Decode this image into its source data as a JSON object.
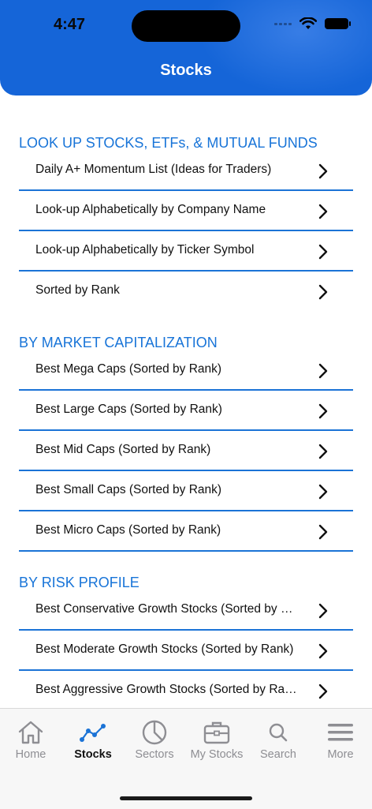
{
  "status": {
    "time": "4:47"
  },
  "header": {
    "title": "Stocks"
  },
  "sections": [
    {
      "title": "LOOK UP STOCKS, ETFs, & MUTUAL FUNDS",
      "items": [
        "Daily A+ Momentum List (Ideas for Traders)",
        "Look-up Alphabetically by Company Name",
        "Look-up Alphabetically by Ticker Symbol",
        "Sorted by Rank"
      ]
    },
    {
      "title": "BY MARKET CAPITALIZATION",
      "items": [
        "Best Mega Caps (Sorted by Rank)",
        "Best Large Caps (Sorted by Rank)",
        "Best Mid Caps (Sorted by Rank)",
        "Best Small Caps (Sorted by Rank)",
        "Best Micro Caps (Sorted by Rank)"
      ]
    },
    {
      "title": "BY RISK PROFILE",
      "items": [
        "Best Conservative Growth Stocks (Sorted by Rank)",
        "Best Moderate Growth Stocks (Sorted by Rank)",
        "Best Aggressive Growth Stocks (Sorted by Rank)"
      ]
    }
  ],
  "tabbar": {
    "tabs": [
      {
        "label": "Home",
        "icon": "home-icon"
      },
      {
        "label": "Stocks",
        "icon": "chart-line-icon"
      },
      {
        "label": "Sectors",
        "icon": "pie-chart-icon"
      },
      {
        "label": "My Stocks",
        "icon": "briefcase-icon"
      },
      {
        "label": "Search",
        "icon": "search-icon"
      },
      {
        "label": "More",
        "icon": "menu-icon"
      }
    ],
    "active": "Stocks"
  },
  "colors": {
    "accent": "#1565d8",
    "section": "#1874d8",
    "divider": "#1b73d6",
    "inactive": "#8e8e93"
  }
}
